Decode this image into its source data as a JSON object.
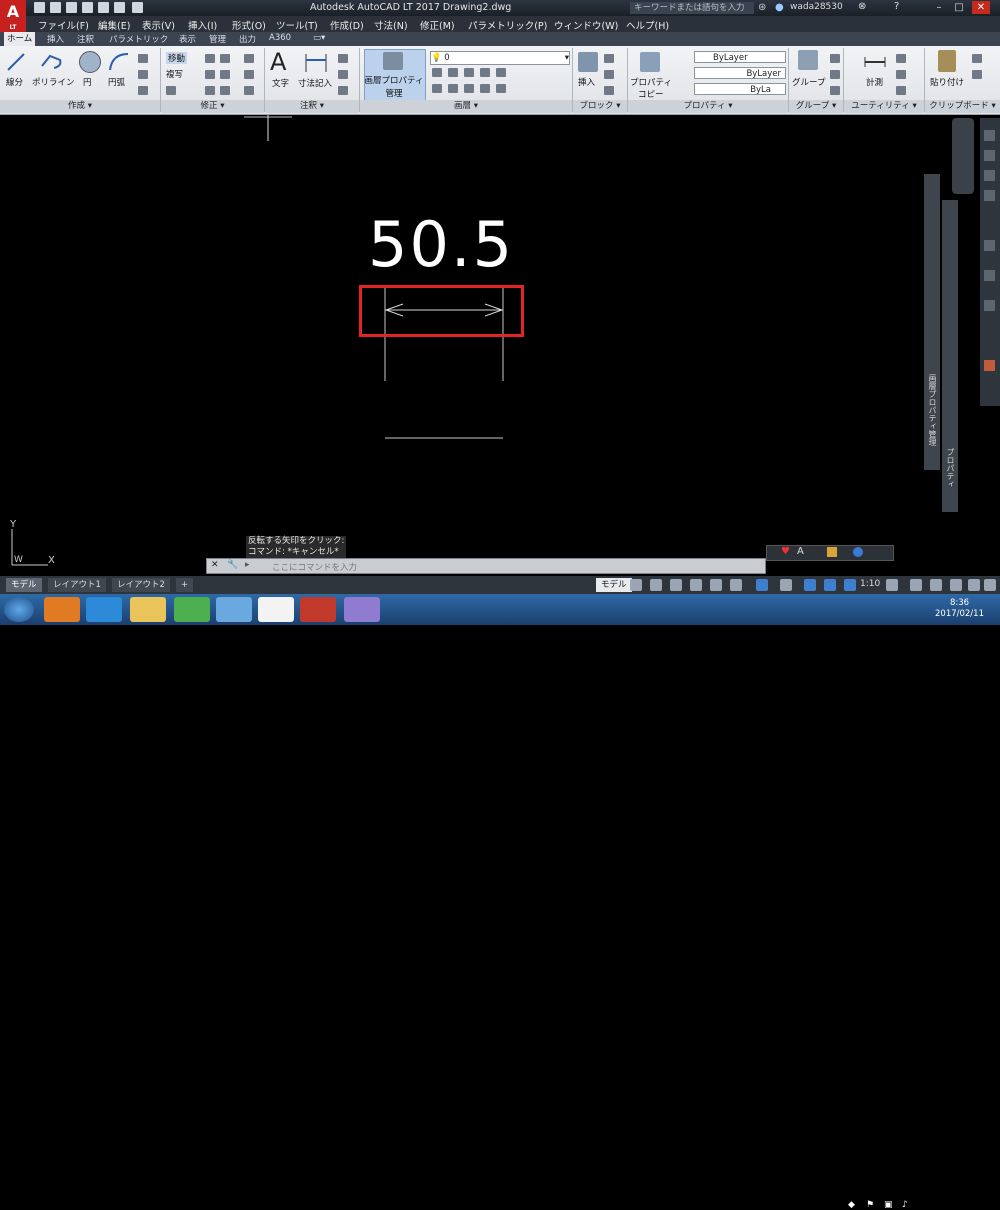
{
  "app": {
    "logo": "A",
    "logo_sub": "LT",
    "title": "Autodesk AutoCAD LT 2017    Drawing2.dwg",
    "search_placeholder": "キーワードまたは語句を入力",
    "user": "wada28530"
  },
  "menubar": [
    "ファイル(F)",
    "編集(E)",
    "表示(V)",
    "挿入(I)",
    "形式(O)",
    "ツール(T)",
    "作成(D)",
    "寸法(N)",
    "修正(M)",
    "パラメトリック(P)",
    "ウィンドウ(W)",
    "ヘルプ(H)"
  ],
  "tabs": [
    "ホーム",
    "挿入",
    "注釈",
    "パラメトリック",
    "表示",
    "管理",
    "出力",
    "A360"
  ],
  "ribbon": {
    "draw": {
      "line": "線分",
      "polyline": "ポリライン",
      "circle": "円",
      "arc": "円弧",
      "title": "作成 ▾"
    },
    "modify": {
      "move": "移動",
      "copy": "複写",
      "title": "修正 ▾"
    },
    "annotation": {
      "text": "文字",
      "dimension": "寸法記入",
      "title": "注釈 ▾"
    },
    "layers": {
      "props_btn_l1": "画層プロパティ",
      "props_btn_l2": "管理",
      "layer_value": "0",
      "title": "画層 ▾"
    },
    "block": {
      "insert": "挿入",
      "title": "ブロック ▾"
    },
    "properties": {
      "match_l1": "プロパティ",
      "match_l2": "コピー",
      "color": "ByLayer",
      "linetype": "ByLayer",
      "lineweight": "ByLa",
      "title": "プロパティ ▾"
    },
    "groups": {
      "group": "グループ",
      "title": "グループ ▾"
    },
    "utilities": {
      "measure": "計測",
      "title": "ユーティリティ ▾"
    },
    "clipboard": {
      "paste": "貼り付け",
      "title": "クリップボード ▾"
    }
  },
  "drawing": {
    "dim_text": "50.5",
    "ucs_y": "Y",
    "ucs_x": "X",
    "ucs_w": "W"
  },
  "side_panels": {
    "layer_props": "画層プロパティ管理",
    "properties": "プロパティ"
  },
  "command": {
    "history_1": "反転する矢印をクリック:",
    "history_2": "コマンド: *キャンセル*",
    "placeholder": "ここにコマンドを入力"
  },
  "layout_tabs": [
    "モデル",
    "レイアウト1",
    "レイアウト2",
    "+"
  ],
  "status": {
    "model": "モデル",
    "scale": "1:10"
  },
  "clock": {
    "time": "8:36",
    "date": "2017/02/11"
  },
  "colors": {
    "highlight": "#e32424",
    "ribbon_bg": "#e4e7eb",
    "canvas": "#000000"
  }
}
